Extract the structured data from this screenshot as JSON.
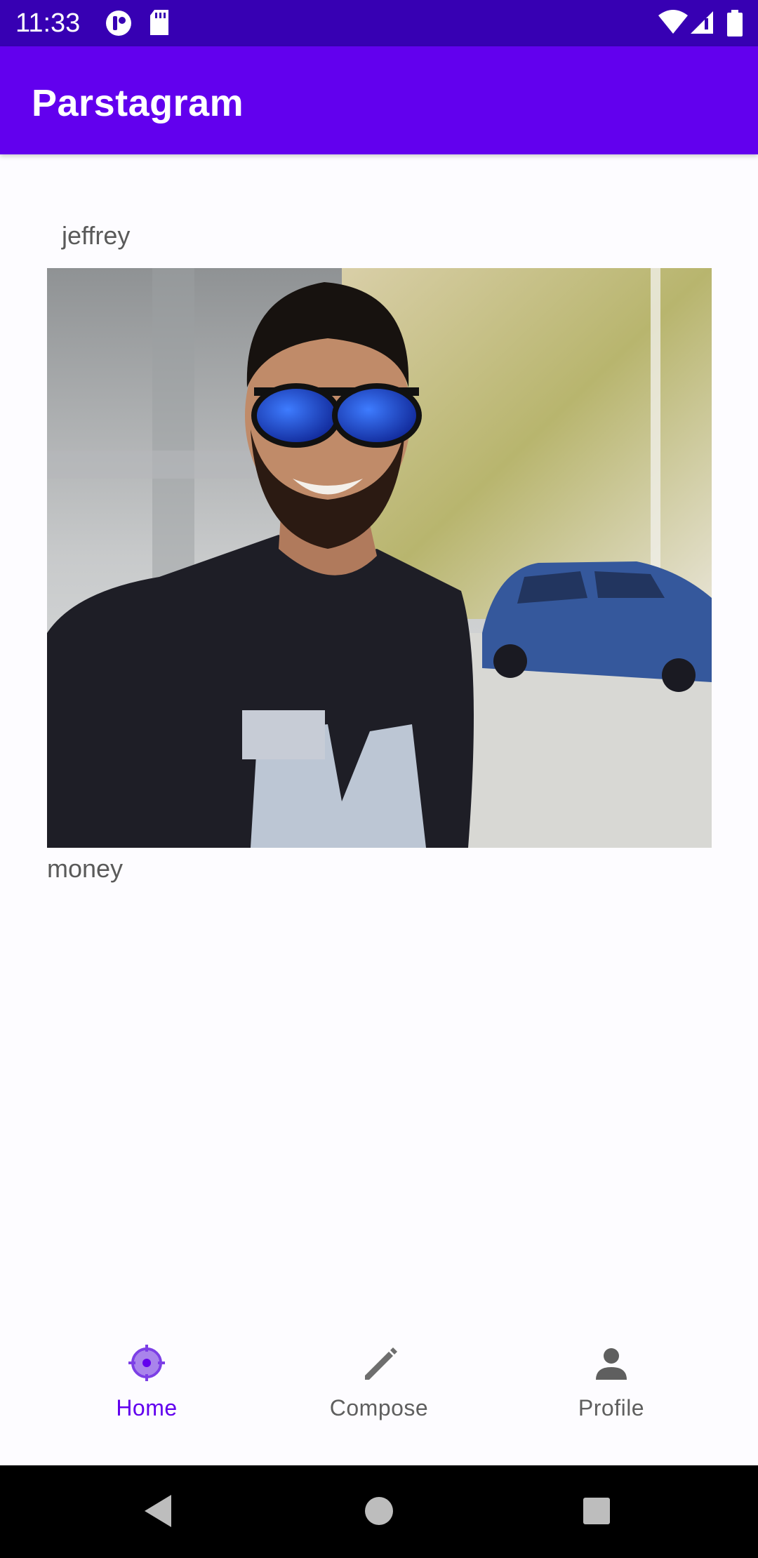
{
  "status_bar": {
    "time": "11:33",
    "icons": [
      "notification-app-icon",
      "sd-card-icon",
      "wifi-icon",
      "cell-signal-icon",
      "battery-icon"
    ]
  },
  "app_bar": {
    "title": "Parstagram"
  },
  "feed": {
    "posts": [
      {
        "username": "jeffrey",
        "image_description": "photo",
        "caption": "money"
      }
    ]
  },
  "bottom_nav": {
    "items": [
      {
        "label": "Home",
        "icon": "home-target-icon",
        "selected": true
      },
      {
        "label": "Compose",
        "icon": "pencil-icon",
        "selected": false
      },
      {
        "label": "Profile",
        "icon": "person-icon",
        "selected": false
      }
    ]
  },
  "colors": {
    "status_bar": "#3700b3",
    "app_bar": "#6200ee",
    "accent": "#6200ee",
    "nav_inactive": "#5f5f5f",
    "background": "#fdfcff"
  },
  "system_nav": {
    "buttons": [
      "back-icon",
      "home-circle-icon",
      "recents-square-icon"
    ]
  }
}
